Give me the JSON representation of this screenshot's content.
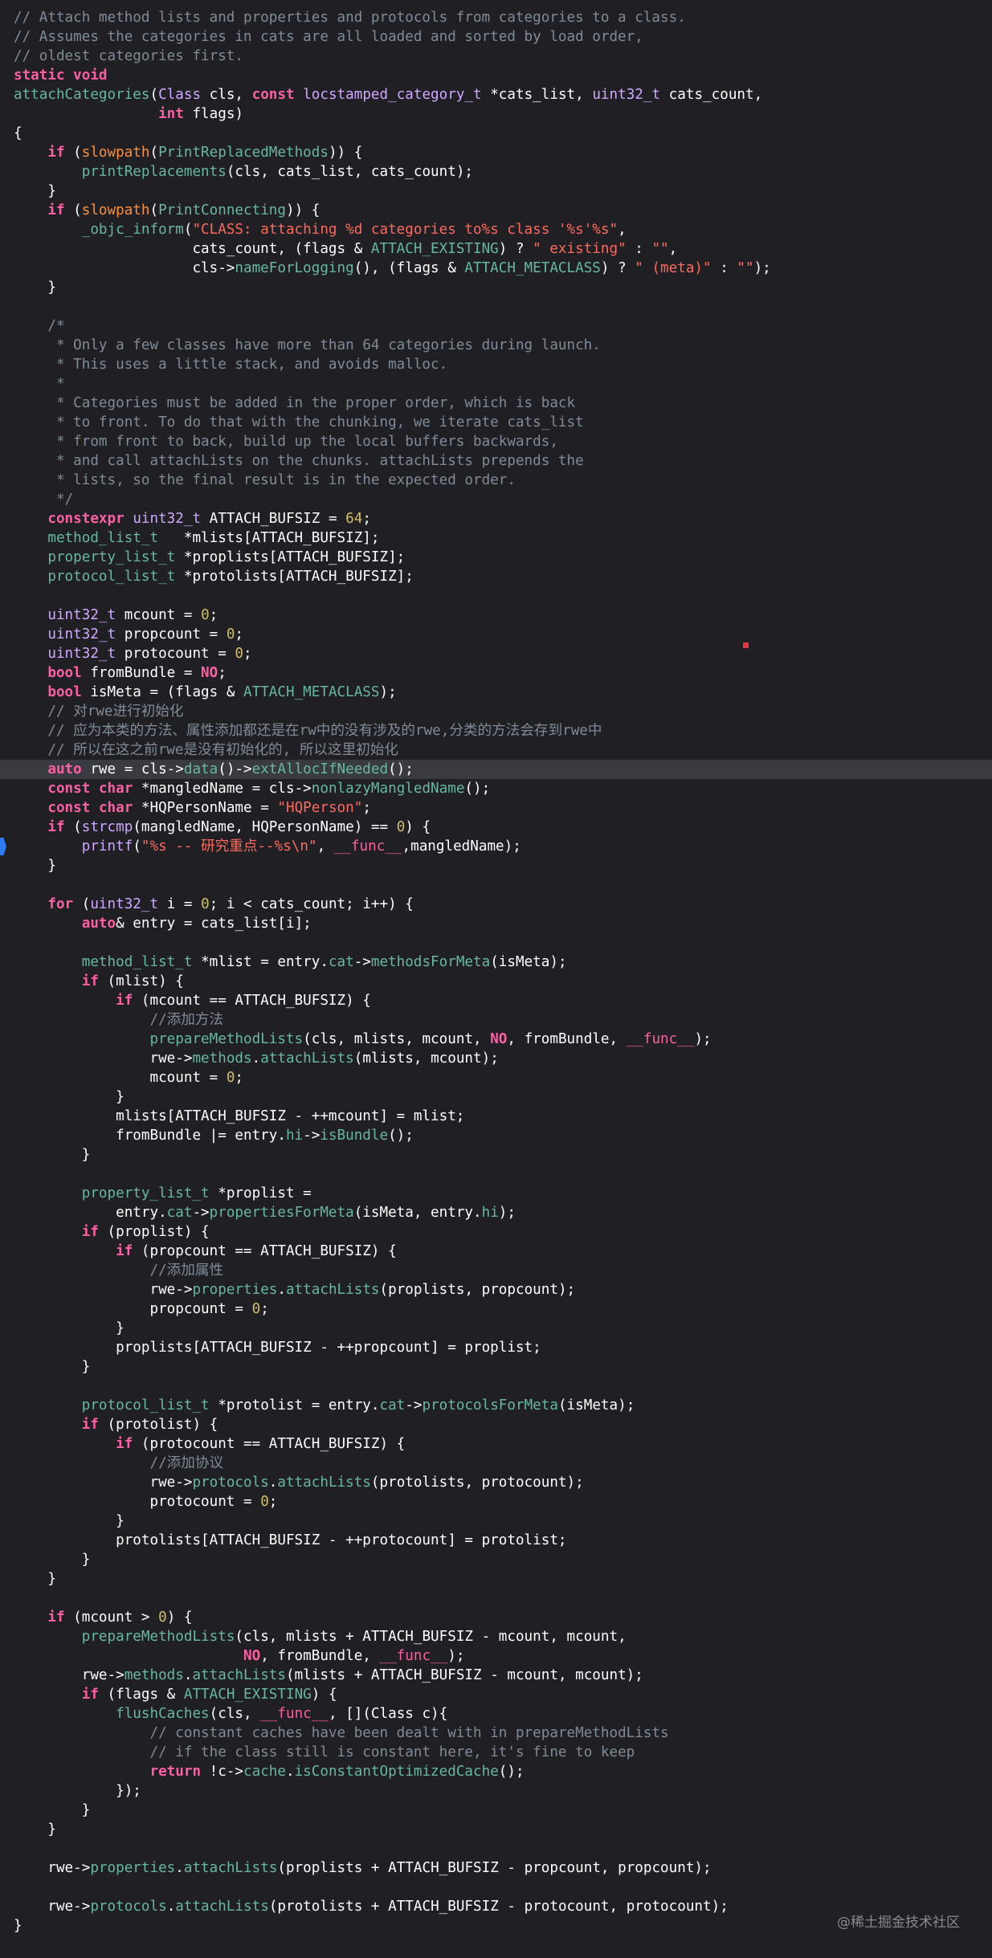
{
  "code_lines": [
    [
      [
        "cm",
        "// Attach method lists and properties and protocols from categories to a class."
      ]
    ],
    [
      [
        "cm",
        "// Assumes the categories in cats are all loaded and sorted by load order,"
      ]
    ],
    [
      [
        "cm",
        "// oldest categories first."
      ]
    ],
    [
      [
        "kw",
        "static"
      ],
      [
        "pl",
        " "
      ],
      [
        "kw",
        "void"
      ]
    ],
    [
      [
        "fn",
        "attachCategories"
      ],
      [
        "pl",
        "("
      ],
      [
        "ty",
        "Class"
      ],
      [
        "pl",
        " cls, "
      ],
      [
        "kw",
        "const"
      ],
      [
        "pl",
        " "
      ],
      [
        "ty",
        "locstamped_category_t"
      ],
      [
        "pl",
        " *cats_list, "
      ],
      [
        "ty",
        "uint32_t"
      ],
      [
        "pl",
        " cats_count,"
      ]
    ],
    [
      [
        "pl",
        "                 "
      ],
      [
        "kw",
        "int"
      ],
      [
        "pl",
        " flags)"
      ]
    ],
    [
      [
        "pl",
        "{"
      ]
    ],
    [
      [
        "pl",
        "    "
      ],
      [
        "kw",
        "if"
      ],
      [
        "pl",
        " ("
      ],
      [
        "mc",
        "slowpath"
      ],
      [
        "pl",
        "("
      ],
      [
        "fn",
        "PrintReplacedMethods"
      ],
      [
        "pl",
        ")) {"
      ]
    ],
    [
      [
        "pl",
        "        "
      ],
      [
        "fn",
        "printReplacements"
      ],
      [
        "pl",
        "(cls, cats_list, cats_count);"
      ]
    ],
    [
      [
        "pl",
        "    }"
      ]
    ],
    [
      [
        "pl",
        "    "
      ],
      [
        "kw",
        "if"
      ],
      [
        "pl",
        " ("
      ],
      [
        "mc",
        "slowpath"
      ],
      [
        "pl",
        "("
      ],
      [
        "fn",
        "PrintConnecting"
      ],
      [
        "pl",
        ")) {"
      ]
    ],
    [
      [
        "pl",
        "        "
      ],
      [
        "fn",
        "_objc_inform"
      ],
      [
        "pl",
        "("
      ],
      [
        "st",
        "\"CLASS: attaching %d categories to%s class '%s'%s\""
      ],
      [
        "pl",
        ","
      ]
    ],
    [
      [
        "pl",
        "                     cats_count, (flags & "
      ],
      [
        "fn",
        "ATTACH_EXISTING"
      ],
      [
        "pl",
        ") ? "
      ],
      [
        "st",
        "\" existing\""
      ],
      [
        "pl",
        " : "
      ],
      [
        "st",
        "\"\""
      ],
      [
        "pl",
        ","
      ]
    ],
    [
      [
        "pl",
        "                     cls->"
      ],
      [
        "fn",
        "nameForLogging"
      ],
      [
        "pl",
        "(), (flags & "
      ],
      [
        "fn",
        "ATTACH_METACLASS"
      ],
      [
        "pl",
        ") ? "
      ],
      [
        "st",
        "\" (meta)\""
      ],
      [
        "pl",
        " : "
      ],
      [
        "st",
        "\"\""
      ],
      [
        "pl",
        ");"
      ]
    ],
    [
      [
        "pl",
        "    }"
      ]
    ],
    [],
    [
      [
        "pl",
        "    "
      ],
      [
        "cm",
        "/*"
      ]
    ],
    [
      [
        "cm",
        "     * Only a few classes have more than 64 categories during launch."
      ]
    ],
    [
      [
        "cm",
        "     * This uses a little stack, and avoids malloc."
      ]
    ],
    [
      [
        "cm",
        "     *"
      ]
    ],
    [
      [
        "cm",
        "     * Categories must be added in the proper order, which is back"
      ]
    ],
    [
      [
        "cm",
        "     * to front. To do that with the chunking, we iterate cats_list"
      ]
    ],
    [
      [
        "cm",
        "     * from front to back, build up the local buffers backwards,"
      ]
    ],
    [
      [
        "cm",
        "     * and call attachLists on the chunks. attachLists prepends the"
      ]
    ],
    [
      [
        "cm",
        "     * lists, so the final result is in the expected order."
      ]
    ],
    [
      [
        "cm",
        "     */"
      ]
    ],
    [
      [
        "pl",
        "    "
      ],
      [
        "kw",
        "constexpr"
      ],
      [
        "pl",
        " "
      ],
      [
        "ty",
        "uint32_t"
      ],
      [
        "pl",
        " ATTACH_BUFSIZ = "
      ],
      [
        "nm",
        "64"
      ],
      [
        "pl",
        ";"
      ]
    ],
    [
      [
        "pl",
        "    "
      ],
      [
        "fn",
        "method_list_t"
      ],
      [
        "pl",
        "   *mlists[ATTACH_BUFSIZ];"
      ]
    ],
    [
      [
        "pl",
        "    "
      ],
      [
        "fn",
        "property_list_t"
      ],
      [
        "pl",
        " *proplists[ATTACH_BUFSIZ];"
      ]
    ],
    [
      [
        "pl",
        "    "
      ],
      [
        "fn",
        "protocol_list_t"
      ],
      [
        "pl",
        " *protolists[ATTACH_BUFSIZ];"
      ]
    ],
    [],
    [
      [
        "pl",
        "    "
      ],
      [
        "ty",
        "uint32_t"
      ],
      [
        "pl",
        " mcount = "
      ],
      [
        "nm",
        "0"
      ],
      [
        "pl",
        ";"
      ]
    ],
    [
      [
        "pl",
        "    "
      ],
      [
        "ty",
        "uint32_t"
      ],
      [
        "pl",
        " propcount = "
      ],
      [
        "nm",
        "0"
      ],
      [
        "pl",
        ";"
      ]
    ],
    [
      [
        "pl",
        "    "
      ],
      [
        "ty",
        "uint32_t"
      ],
      [
        "pl",
        " protocount = "
      ],
      [
        "nm",
        "0"
      ],
      [
        "pl",
        ";"
      ]
    ],
    [
      [
        "pl",
        "    "
      ],
      [
        "kw",
        "bool"
      ],
      [
        "pl",
        " fromBundle = "
      ],
      [
        "kw",
        "NO"
      ],
      [
        "pl",
        ";"
      ]
    ],
    [
      [
        "pl",
        "    "
      ],
      [
        "kw",
        "bool"
      ],
      [
        "pl",
        " isMeta = (flags & "
      ],
      [
        "fn",
        "ATTACH_METACLASS"
      ],
      [
        "pl",
        ");"
      ]
    ],
    [
      [
        "pl",
        "    "
      ],
      [
        "cm",
        "// 对rwe进行初始化"
      ]
    ],
    [
      [
        "pl",
        "    "
      ],
      [
        "cm",
        "// 应为本类的方法、属性添加都还是在rw中的没有涉及的rwe,分类的方法会存到rwe中"
      ]
    ],
    [
      [
        "pl",
        "    "
      ],
      [
        "cm",
        "// 所以在这之前rwe是没有初始化的, 所以这里初始化"
      ]
    ],
    [
      [
        "pl",
        "    "
      ],
      [
        "kw",
        "auto"
      ],
      [
        "pl",
        " rwe = cls->"
      ],
      [
        "fn",
        "data"
      ],
      [
        "pl",
        "()->"
      ],
      [
        "fn",
        "extAllocIfNeeded"
      ],
      [
        "pl",
        "();"
      ]
    ],
    [
      [
        "pl",
        "    "
      ],
      [
        "kw",
        "const"
      ],
      [
        "pl",
        " "
      ],
      [
        "kw",
        "char"
      ],
      [
        "pl",
        " *mangledName = cls->"
      ],
      [
        "fn",
        "nonlazyMangledName"
      ],
      [
        "pl",
        "();"
      ]
    ],
    [
      [
        "pl",
        "    "
      ],
      [
        "kw",
        "const"
      ],
      [
        "pl",
        " "
      ],
      [
        "kw",
        "char"
      ],
      [
        "pl",
        " *HQPersonName = "
      ],
      [
        "st",
        "\"HQPerson\""
      ],
      [
        "pl",
        ";"
      ]
    ],
    [
      [
        "pl",
        "    "
      ],
      [
        "kw",
        "if"
      ],
      [
        "pl",
        " ("
      ],
      [
        "ty",
        "strcmp"
      ],
      [
        "pl",
        "(mangledName, HQPersonName) == "
      ],
      [
        "nm",
        "0"
      ],
      [
        "pl",
        ") {"
      ]
    ],
    [
      [
        "pl",
        "        "
      ],
      [
        "ty",
        "printf"
      ],
      [
        "pl",
        "("
      ],
      [
        "st",
        "\"%s -- 研究重点--%s\\n\""
      ],
      [
        "pl",
        ", "
      ],
      [
        "bp",
        "__func__"
      ],
      [
        "pl",
        ",mangledName);"
      ]
    ],
    [
      [
        "pl",
        "    }"
      ]
    ],
    [],
    [
      [
        "pl",
        "    "
      ],
      [
        "kw",
        "for"
      ],
      [
        "pl",
        " ("
      ],
      [
        "ty",
        "uint32_t"
      ],
      [
        "pl",
        " i = "
      ],
      [
        "nm",
        "0"
      ],
      [
        "pl",
        "; i < cats_count; i++) {"
      ]
    ],
    [
      [
        "pl",
        "        "
      ],
      [
        "kw",
        "auto"
      ],
      [
        "pl",
        "& entry = cats_list[i];"
      ]
    ],
    [],
    [
      [
        "pl",
        "        "
      ],
      [
        "fn",
        "method_list_t"
      ],
      [
        "pl",
        " *mlist = entry."
      ],
      [
        "fn",
        "cat"
      ],
      [
        "pl",
        "->"
      ],
      [
        "fn",
        "methodsForMeta"
      ],
      [
        "pl",
        "(isMeta);"
      ]
    ],
    [
      [
        "pl",
        "        "
      ],
      [
        "kw",
        "if"
      ],
      [
        "pl",
        " (mlist) {"
      ]
    ],
    [
      [
        "pl",
        "            "
      ],
      [
        "kw",
        "if"
      ],
      [
        "pl",
        " (mcount == ATTACH_BUFSIZ) {"
      ]
    ],
    [
      [
        "pl",
        "                "
      ],
      [
        "cm",
        "//添加方法"
      ]
    ],
    [
      [
        "pl",
        "                "
      ],
      [
        "fn",
        "prepareMethodLists"
      ],
      [
        "pl",
        "(cls, mlists, mcount, "
      ],
      [
        "kw",
        "NO"
      ],
      [
        "pl",
        ", fromBundle, "
      ],
      [
        "bp",
        "__func__"
      ],
      [
        "pl",
        ");"
      ]
    ],
    [
      [
        "pl",
        "                rwe->"
      ],
      [
        "fn",
        "methods"
      ],
      [
        "pl",
        "."
      ],
      [
        "fn",
        "attachLists"
      ],
      [
        "pl",
        "(mlists, mcount);"
      ]
    ],
    [
      [
        "pl",
        "                mcount = "
      ],
      [
        "nm",
        "0"
      ],
      [
        "pl",
        ";"
      ]
    ],
    [
      [
        "pl",
        "            }"
      ]
    ],
    [
      [
        "pl",
        "            mlists[ATTACH_BUFSIZ - ++mcount] = mlist;"
      ]
    ],
    [
      [
        "pl",
        "            fromBundle |= entry."
      ],
      [
        "fn",
        "hi"
      ],
      [
        "pl",
        "->"
      ],
      [
        "fn",
        "isBundle"
      ],
      [
        "pl",
        "();"
      ]
    ],
    [
      [
        "pl",
        "        }"
      ]
    ],
    [],
    [
      [
        "pl",
        "        "
      ],
      [
        "fn",
        "property_list_t"
      ],
      [
        "pl",
        " *proplist ="
      ]
    ],
    [
      [
        "pl",
        "            entry."
      ],
      [
        "fn",
        "cat"
      ],
      [
        "pl",
        "->"
      ],
      [
        "fn",
        "propertiesForMeta"
      ],
      [
        "pl",
        "(isMeta, entry."
      ],
      [
        "fn",
        "hi"
      ],
      [
        "pl",
        ");"
      ]
    ],
    [
      [
        "pl",
        "        "
      ],
      [
        "kw",
        "if"
      ],
      [
        "pl",
        " (proplist) {"
      ]
    ],
    [
      [
        "pl",
        "            "
      ],
      [
        "kw",
        "if"
      ],
      [
        "pl",
        " (propcount == ATTACH_BUFSIZ) {"
      ]
    ],
    [
      [
        "pl",
        "                "
      ],
      [
        "cm",
        "//添加属性"
      ]
    ],
    [
      [
        "pl",
        "                rwe->"
      ],
      [
        "fn",
        "properties"
      ],
      [
        "pl",
        "."
      ],
      [
        "fn",
        "attachLists"
      ],
      [
        "pl",
        "(proplists, propcount);"
      ]
    ],
    [
      [
        "pl",
        "                propcount = "
      ],
      [
        "nm",
        "0"
      ],
      [
        "pl",
        ";"
      ]
    ],
    [
      [
        "pl",
        "            }"
      ]
    ],
    [
      [
        "pl",
        "            proplists[ATTACH_BUFSIZ - ++propcount] = proplist;"
      ]
    ],
    [
      [
        "pl",
        "        }"
      ]
    ],
    [],
    [
      [
        "pl",
        "        "
      ],
      [
        "fn",
        "protocol_list_t"
      ],
      [
        "pl",
        " *protolist = entry."
      ],
      [
        "fn",
        "cat"
      ],
      [
        "pl",
        "->"
      ],
      [
        "fn",
        "protocolsForMeta"
      ],
      [
        "pl",
        "(isMeta);"
      ]
    ],
    [
      [
        "pl",
        "        "
      ],
      [
        "kw",
        "if"
      ],
      [
        "pl",
        " (protolist) {"
      ]
    ],
    [
      [
        "pl",
        "            "
      ],
      [
        "kw",
        "if"
      ],
      [
        "pl",
        " (protocount == ATTACH_BUFSIZ) {"
      ]
    ],
    [
      [
        "pl",
        "                "
      ],
      [
        "cm",
        "//添加协议"
      ]
    ],
    [
      [
        "pl",
        "                rwe->"
      ],
      [
        "fn",
        "protocols"
      ],
      [
        "pl",
        "."
      ],
      [
        "fn",
        "attachLists"
      ],
      [
        "pl",
        "(protolists, protocount);"
      ]
    ],
    [
      [
        "pl",
        "                protocount = "
      ],
      [
        "nm",
        "0"
      ],
      [
        "pl",
        ";"
      ]
    ],
    [
      [
        "pl",
        "            }"
      ]
    ],
    [
      [
        "pl",
        "            protolists[ATTACH_BUFSIZ - ++protocount] = protolist;"
      ]
    ],
    [
      [
        "pl",
        "        }"
      ]
    ],
    [
      [
        "pl",
        "    }"
      ]
    ],
    [],
    [
      [
        "pl",
        "    "
      ],
      [
        "kw",
        "if"
      ],
      [
        "pl",
        " (mcount > "
      ],
      [
        "nm",
        "0"
      ],
      [
        "pl",
        ") {"
      ]
    ],
    [
      [
        "pl",
        "        "
      ],
      [
        "fn",
        "prepareMethodLists"
      ],
      [
        "pl",
        "(cls, mlists + ATTACH_BUFSIZ - mcount, mcount,"
      ]
    ],
    [
      [
        "pl",
        "                           "
      ],
      [
        "kw",
        "NO"
      ],
      [
        "pl",
        ", fromBundle, "
      ],
      [
        "bp",
        "__func__"
      ],
      [
        "pl",
        ");"
      ]
    ],
    [
      [
        "pl",
        "        rwe->"
      ],
      [
        "fn",
        "methods"
      ],
      [
        "pl",
        "."
      ],
      [
        "fn",
        "attachLists"
      ],
      [
        "pl",
        "(mlists + ATTACH_BUFSIZ - mcount, mcount);"
      ]
    ],
    [
      [
        "pl",
        "        "
      ],
      [
        "kw",
        "if"
      ],
      [
        "pl",
        " (flags & "
      ],
      [
        "fn",
        "ATTACH_EXISTING"
      ],
      [
        "pl",
        ") {"
      ]
    ],
    [
      [
        "pl",
        "            "
      ],
      [
        "fn",
        "flushCaches"
      ],
      [
        "pl",
        "(cls, "
      ],
      [
        "bp",
        "__func__"
      ],
      [
        "pl",
        ", [](Class c){"
      ]
    ],
    [
      [
        "pl",
        "                "
      ],
      [
        "cm",
        "// constant caches have been dealt with in prepareMethodLists"
      ]
    ],
    [
      [
        "pl",
        "                "
      ],
      [
        "cm",
        "// if the class still is constant here, it's fine to keep"
      ]
    ],
    [
      [
        "pl",
        "                "
      ],
      [
        "kw",
        "return"
      ],
      [
        "pl",
        " !c->"
      ],
      [
        "fn",
        "cache"
      ],
      [
        "pl",
        "."
      ],
      [
        "fn",
        "isConstantOptimizedCache"
      ],
      [
        "pl",
        "();"
      ]
    ],
    [
      [
        "pl",
        "            });"
      ]
    ],
    [
      [
        "pl",
        "        }"
      ]
    ],
    [
      [
        "pl",
        "    }"
      ]
    ],
    [],
    [
      [
        "pl",
        "    rwe->"
      ],
      [
        "fn",
        "properties"
      ],
      [
        "pl",
        "."
      ],
      [
        "fn",
        "attachLists"
      ],
      [
        "pl",
        "(proplists + ATTACH_BUFSIZ - propcount, propcount);"
      ]
    ],
    [],
    [
      [
        "pl",
        "    rwe->"
      ],
      [
        "fn",
        "protocols"
      ],
      [
        "pl",
        "."
      ],
      [
        "fn",
        "attachLists"
      ],
      [
        "pl",
        "(protolists + ATTACH_BUFSIZ - protocount, protocount);"
      ]
    ],
    [
      [
        "pl",
        "}"
      ]
    ]
  ],
  "highlighted_line": 39,
  "breakpoint_line": 43,
  "watermark": "@稀土掘金技术社区"
}
